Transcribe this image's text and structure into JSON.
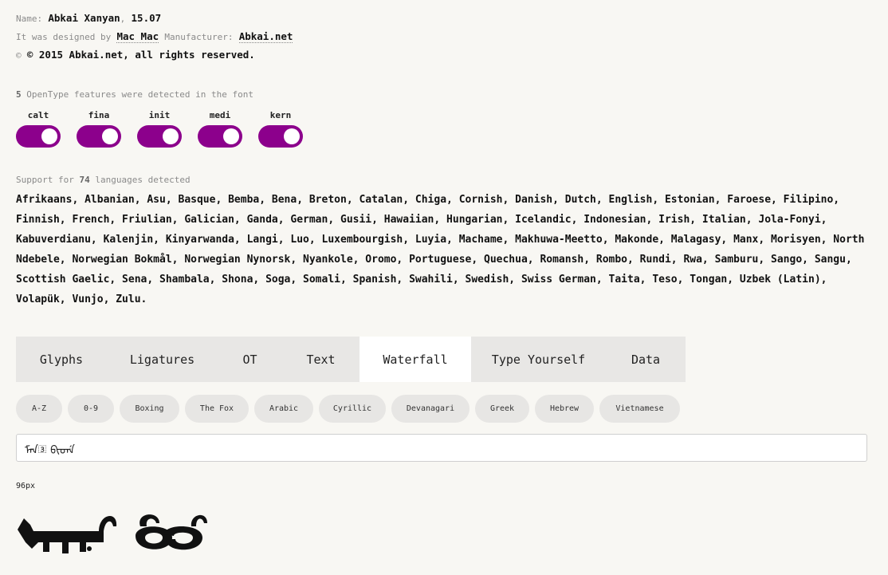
{
  "meta": {
    "name_label": "Name:",
    "font_name": "Abkai Xanyan",
    "separator": ",",
    "version": "15.07",
    "designed_label": "It was designed by",
    "designer": "Mac Mac",
    "manufacturer_label": "Manufacturer:",
    "manufacturer": "Abkai.net",
    "copyright_symbol": "©",
    "copyright": "© 2015 Abkai.net, all rights reserved."
  },
  "opentype": {
    "count": "5",
    "label": "OpenType features were detected in the font",
    "features": [
      {
        "label": "calt",
        "enabled": true
      },
      {
        "label": "fina",
        "enabled": true
      },
      {
        "label": "init",
        "enabled": true
      },
      {
        "label": "medi",
        "enabled": true
      },
      {
        "label": "kern",
        "enabled": true
      }
    ],
    "toggle_color": "#8c008c"
  },
  "languages": {
    "prefix": "Support for",
    "count": "74",
    "suffix": "languages detected",
    "list": "Afrikaans, Albanian, Asu, Basque, Bemba, Bena, Breton, Catalan, Chiga, Cornish, Danish, Dutch, English, Estonian, Faroese, Filipino, Finnish, French, Friulian, Galician, Ganda, German, Gusii, Hawaiian, Hungarian, Icelandic, Indonesian, Irish, Italian, Jola-Fonyi, Kabuverdianu, Kalenjin, Kinyarwanda, Langi, Luo, Luxembourgish, Luyia, Machame, Makhuwa-Meetto, Makonde, Malagasy, Manx, Morisyen, North Ndebele, Norwegian Bokmål, Norwegian Nynorsk, Nyankole, Oromo, Portuguese, Quechua, Romansh, Rombo, Rundi, Rwa, Samburu, Sango, Sangu, Scottish Gaelic, Sena, Shambala, Shona, Soga, Somali, Spanish, Swahili, Swedish, Swiss German, Taita, Teso, Tongan, Uzbek (Latin), Volapük, Vunjo, Zulu."
  },
  "tabs": [
    {
      "label": "Glyphs",
      "active": false
    },
    {
      "label": "Ligatures",
      "active": false
    },
    {
      "label": "OT",
      "active": false
    },
    {
      "label": "Text",
      "active": false
    },
    {
      "label": "Waterfall",
      "active": true
    },
    {
      "label": "Type Yourself",
      "active": false
    },
    {
      "label": "Data",
      "active": false
    }
  ],
  "pills": [
    "A-Z",
    "0-9",
    "Boxing",
    "The Fox",
    "Arabic",
    "Cyrillic",
    "Devanagari",
    "Greek",
    "Hebrew",
    "Vietnamese"
  ],
  "sample": {
    "value": "ᠮᠠᠨ᠍ ᠪᠢᠳᡝ",
    "size_label": "96px",
    "preview_icon": "manchu-script-sample"
  }
}
